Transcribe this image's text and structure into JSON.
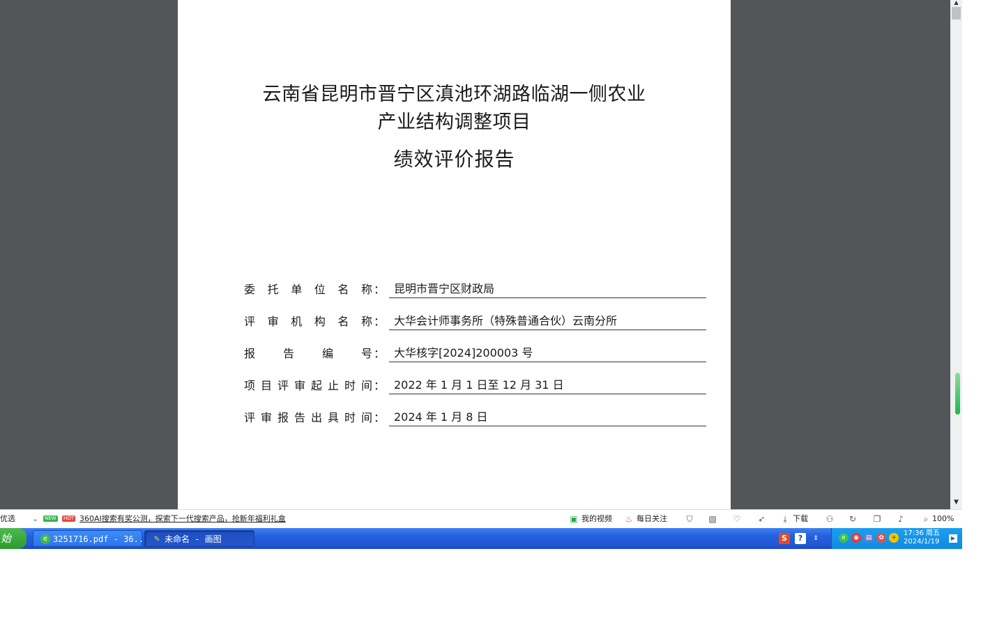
{
  "document": {
    "title_line1": "云南省昆明市晋宁区滇池环湖路临湖一侧农业",
    "title_line2": "产业结构调整项目",
    "title_line3": "绩效评价报告",
    "fields": [
      {
        "label": "委托单位名称",
        "colon": "：",
        "value": "昆明市晋宁区财政局"
      },
      {
        "label": "评审机构名称",
        "colon": "：",
        "value": "大华会计师事务所（特殊普通合伙）云南分所"
      },
      {
        "label": "报告编号",
        "colon": "：",
        "value": "大华核字[2024]200003 号"
      },
      {
        "label": "项目评审起止时间",
        "colon": "：",
        "value": "2022 年 1 月 1 日至 12 月 31 日"
      },
      {
        "label": "评审报告出具时间",
        "colon": "：",
        "value": "2024 年 1 月 8 日"
      }
    ]
  },
  "statusbar": {
    "left_text": "优选",
    "badge_new": "NEW",
    "badge_hot": "HOT",
    "news_link": "360AI搜索有奖公测，探索下一代搜索产品，抢新年福利礼盒",
    "my_video": "我的视频",
    "daily_follow": "每日关注",
    "download": "下载",
    "zoom": "100%"
  },
  "taskbar": {
    "start_label": "始",
    "tasks": [
      {
        "label": "3251716.pdf - 36..."
      },
      {
        "label": "未命名 - 画图"
      }
    ],
    "tray_sogou": "S",
    "tray_help": "?",
    "clock_time": "17:36 周五",
    "clock_date": "2024/1/19"
  },
  "icons": {
    "video": "play-icon",
    "fire": "fire-icon",
    "shield": "shield-icon",
    "image": "image-icon",
    "heart": "heart-icon",
    "rocket": "rocket-icon",
    "download": "download-icon",
    "glasses": "glasses-icon",
    "refresh": "refresh-icon",
    "window": "window-icon",
    "sound": "sound-icon",
    "zoom": "zoom-icon"
  },
  "colors": {
    "viewer_bg": "#525659",
    "taskbar_blue": "#245edc",
    "start_green": "#3aa93a",
    "scroll_green": "#19b84a"
  }
}
